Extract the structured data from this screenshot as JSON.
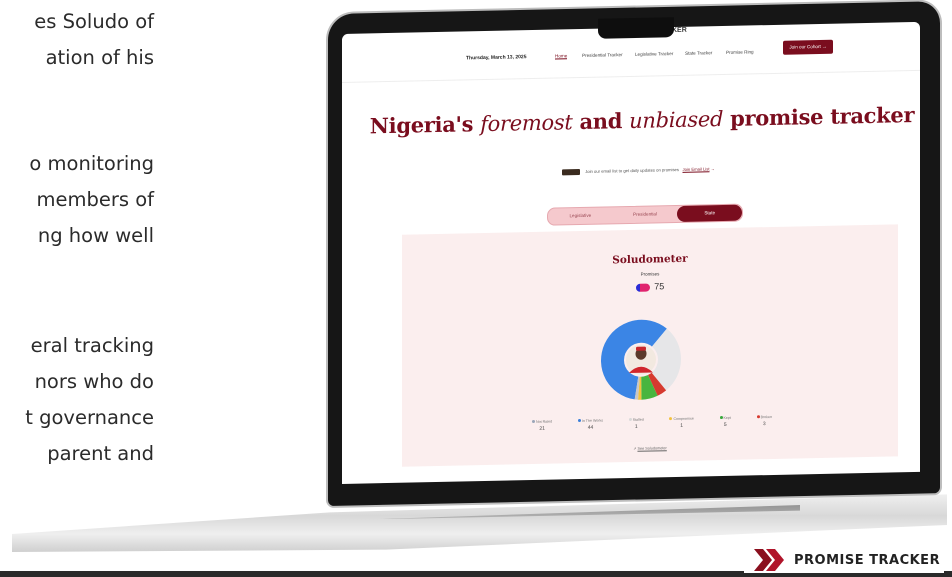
{
  "article": {
    "lines": [
      "es Soludo of",
      "ation of his",
      "",
      "o monitoring",
      " members of",
      "ng how well",
      "",
      "eral tracking",
      "nors who do",
      "t governance",
      "parent and"
    ]
  },
  "site": {
    "brand": "KER",
    "date": "Thursday, March 13, 2025",
    "nav": [
      "Home",
      "Presidential Tracker",
      "Legislative Tracker",
      "State Tracker",
      "Promise Ring"
    ],
    "join_button": "Join our Cohort",
    "headline_part1": "Nigeria's ",
    "headline_part2": "foremost",
    "headline_part3": " and ",
    "headline_part4": "unbiased",
    "headline_part5": " promise tracker",
    "subscribe_text": "Join our email list to get daily updates on promises",
    "subscribe_link": "Join Email List",
    "tabs": [
      "Legislative",
      "Presidential",
      "State"
    ],
    "active_tab": "State"
  },
  "meter": {
    "title": "Soludometer",
    "promises_label": "Promises",
    "promise_count": "75",
    "legend": [
      {
        "label": "Not Rated",
        "value": "21",
        "color": "#9aa6b8"
      },
      {
        "label": "In The Works",
        "value": "44",
        "color": "#3b7fd9"
      },
      {
        "label": "Stalled",
        "value": "1",
        "color": "#d9d9d9"
      },
      {
        "label": "Compromise",
        "value": "1",
        "color": "#f3c23d"
      },
      {
        "label": "Kept",
        "value": "5",
        "color": "#38a83c"
      },
      {
        "label": "Broken",
        "value": "3",
        "color": "#d63a2f"
      }
    ],
    "see_link": "See Soludometer",
    "slices": [
      {
        "name": "In The Works",
        "value": 44,
        "color": "#3b85e5"
      },
      {
        "name": "Not Rated",
        "value": 21,
        "color": "#e6e6e8"
      },
      {
        "name": "Broken",
        "value": 3,
        "color": "#d63a2f"
      },
      {
        "name": "Kept",
        "value": 5,
        "color": "#48b53f"
      },
      {
        "name": "Compromise",
        "value": 1,
        "color": "#f3c23d"
      },
      {
        "name": "Stalled",
        "value": 1,
        "color": "#c7c7c7"
      }
    ]
  },
  "logo": {
    "wordmark": "PROMISE TRACKER"
  }
}
